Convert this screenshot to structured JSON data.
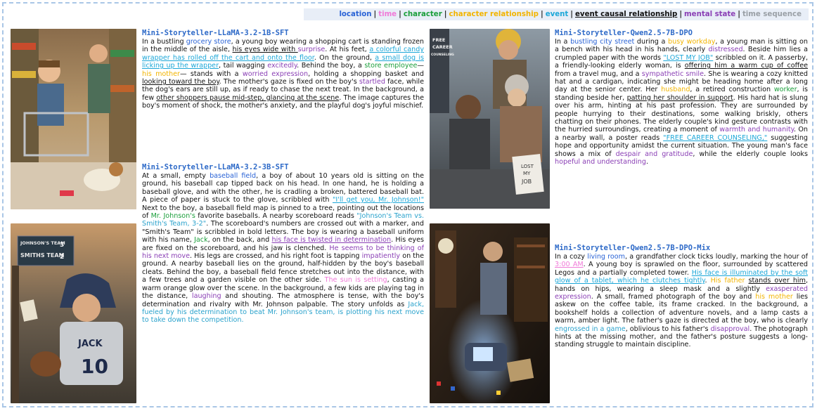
{
  "legend": [
    {
      "label": "location",
      "cls": "l-location"
    },
    {
      "label": "time",
      "cls": "l-time"
    },
    {
      "label": "character",
      "cls": "l-character"
    },
    {
      "label": "character relationship",
      "cls": "l-relationship"
    },
    {
      "label": "event",
      "cls": "l-event"
    },
    {
      "label": "event causal relationship",
      "cls": "l-causal"
    },
    {
      "label": "mental state",
      "cls": "l-mental"
    },
    {
      "label": "time sequence",
      "cls": "l-sequence"
    }
  ],
  "stories": [
    {
      "title": "Mini-Storyteller-LLaMA-3.2-1B-SFT",
      "segments": [
        [
          "In a bustling ",
          ""
        ],
        [
          "grocery store",
          "location"
        ],
        [
          ", a young boy wearing a shopping cart is standing frozen in the middle of the aisle, ",
          ""
        ],
        [
          "his eyes wide with ",
          "causal"
        ],
        [
          "surprise",
          "mental"
        ],
        [
          ". At his feet, ",
          ""
        ],
        [
          "a colorful candy wrapper has rolled off the cart and onto the floor",
          "event"
        ],
        [
          ". On the ground, ",
          ""
        ],
        [
          "a small dog is licking up the wrapper",
          "event"
        ],
        [
          ", tail wagging ",
          ""
        ],
        [
          "excitedly",
          "mental"
        ],
        [
          ". Behind the boy, a ",
          ""
        ],
        [
          "store employee",
          "character"
        ],
        [
          "—",
          ""
        ],
        [
          "his mother",
          "relationship"
        ],
        [
          "— stands with a ",
          ""
        ],
        [
          "worried expression",
          "mental"
        ],
        [
          ", holding a shopping basket and ",
          ""
        ],
        [
          "looking toward the boy",
          "causal"
        ],
        [
          ". The mother's gaze is fixed on the boy's ",
          ""
        ],
        [
          "startled",
          "mental"
        ],
        [
          " face, while the dog's ears are still up, as if ready to chase the next treat. In the background, a few ",
          ""
        ],
        [
          "other shoppers pause mid-step, glancing at the scene",
          "causal"
        ],
        [
          ". The image captures the boy's moment of shock, the mother's anxiety, and the playful dog's joyful mischief.",
          ""
        ]
      ]
    },
    {
      "title": "Mini-Storyteller-LLaMA-3.2-3B-SFT",
      "segments": [
        [
          "At a small, empty ",
          ""
        ],
        [
          "baseball field",
          "location"
        ],
        [
          ", a boy of about 10 years old is sitting on the ground, his baseball cap tipped back on his head. In one hand, he is holding a baseball glove, and with the other, he is cradling a broken, battered baseball bat. A piece of paper is stuck to the glove, scribbled with ",
          ""
        ],
        [
          "\"I'll get you, Mr. Johnson!\"",
          "event"
        ],
        [
          " Next to the boy, a baseball field map is pinned to a tree, pointing out the locations of ",
          ""
        ],
        [
          "Mr. Johnson's",
          "character"
        ],
        [
          " favorite baseballs. A nearby scoreboard reads ",
          ""
        ],
        [
          "\"Johnson's Team vs. Smith's Team, 3-2\"",
          "sequence"
        ],
        [
          ". The scoreboard's numbers are crossed out with a marker, and \"Smith's Team\" is scribbled in bold letters. The boy is wearing a baseball uniform with his name, ",
          ""
        ],
        [
          "Jack",
          "character"
        ],
        [
          ", on the back, and ",
          ""
        ],
        [
          "his face is twisted in determination",
          "mental-u"
        ],
        [
          ". His eyes are fixed on the scoreboard, and his jaw is clenched. ",
          ""
        ],
        [
          "He seems to be thinking of his next move",
          "mental"
        ],
        [
          ". His legs are crossed, and his right foot is tapping ",
          ""
        ],
        [
          "impatiently",
          "mental"
        ],
        [
          " on the ground. A nearby baseball lies on the ground, half-hidden by the boy's baseball cleats. Behind the boy, a baseball field fence stretches out into the distance, with a few trees and a garden visible on the other side. ",
          ""
        ],
        [
          "The sun is setting",
          "time"
        ],
        [
          ", casting a warm orange glow over the scene. In the background, a few kids are playing tag in the distance, ",
          ""
        ],
        [
          "laughing",
          "mental"
        ],
        [
          " and shouting. The atmosphere is tense, with the boy's determination and rivalry with Mr. Johnson palpable. The story unfolds as ",
          ""
        ],
        [
          "Jack, fueled by his determination to beat Mr. Johnson's team, is plotting his next move to take down the competition.",
          "sequence"
        ]
      ]
    },
    {
      "title": "Mini-Storyteller-Qwen2.5-7B-DPO",
      "segments": [
        [
          "In a ",
          ""
        ],
        [
          "bustling city street",
          "location"
        ],
        [
          " during a ",
          ""
        ],
        [
          "busy workday",
          "relationship"
        ],
        [
          ", a young man is sitting on a bench with his head in his hands, clearly ",
          ""
        ],
        [
          "distressed",
          "mental"
        ],
        [
          ". Beside him lies a crumpled paper with the words ",
          ""
        ],
        [
          "\"LOST MY JOB\"",
          "event"
        ],
        [
          " scribbled on it. A passerby, a friendly-looking elderly woman, is ",
          ""
        ],
        [
          "offering him a warm cup of coffee",
          "causal"
        ],
        [
          " from a travel mug, and a ",
          ""
        ],
        [
          "sympathetic smile",
          "mental"
        ],
        [
          ". She is wearing a cozy knitted hat and a cardigan, indicating she might be heading home after a long day at the senior center. Her ",
          ""
        ],
        [
          "husband",
          "relationship"
        ],
        [
          ", a retired construction ",
          ""
        ],
        [
          "worker",
          "character"
        ],
        [
          ", is standing beside her, ",
          ""
        ],
        [
          "patting her shoulder in support",
          "causal"
        ],
        [
          ". His hard hat is slung over his arm, hinting at his past profession. They are surrounded by people hurrying to their destinations, some walking briskly, others chatting on their phones. The elderly couple's kind gesture contrasts with the hurried surroundings, creating a moment of ",
          ""
        ],
        [
          "warmth and humanity",
          "mental"
        ],
        [
          ". On a nearby wall, a poster reads ",
          ""
        ],
        [
          "\"FREE CAREER COUNSELING,\"",
          "event"
        ],
        [
          " suggesting hope and opportunity amidst the current situation. The young man's face shows a mix of ",
          ""
        ],
        [
          "despair and gratitude",
          "mental"
        ],
        [
          ", while the elderly couple looks ",
          ""
        ],
        [
          "hopeful and understanding",
          "mental"
        ],
        [
          ".",
          ""
        ]
      ]
    },
    {
      "title": "Mini-Storyteller-Qwen2.5-7B-DPO-Mix",
      "segments": [
        [
          "In a cozy ",
          ""
        ],
        [
          "living room",
          "location"
        ],
        [
          ", a grandfather clock ticks loudly, marking the hour of ",
          ""
        ],
        [
          "3:00 AM",
          "time-u"
        ],
        [
          ". A young boy is sprawled on the floor, surrounded by scattered Legos and a partially completed tower. ",
          ""
        ],
        [
          "His face is illuminated by the soft glow of a tablet, which he clutches tightly",
          "event"
        ],
        [
          ". ",
          ""
        ],
        [
          "His father",
          "relationship"
        ],
        [
          " ",
          ""
        ],
        [
          "stands over him",
          "causal"
        ],
        [
          ", hands on hips, wearing a sleep mask and a slightly ",
          ""
        ],
        [
          "exasperated expression",
          "mental"
        ],
        [
          ". A small, framed photograph of the boy and ",
          ""
        ],
        [
          "his mother",
          "relationship"
        ],
        [
          " lies askew on the coffee table, its frame cracked. In the background, a bookshelf holds a collection of adventure novels, and a lamp casts a warm, amber light. The father's gaze is directed at the boy, who is clearly ",
          ""
        ],
        [
          "engrossed in a game",
          "sequence"
        ],
        [
          ", oblivious to his father's ",
          ""
        ],
        [
          "disapproval",
          "mental"
        ],
        [
          ". The photograph hints at the missing mother, and the father's posture suggests a long-standing struggle to maintain discipline.",
          ""
        ]
      ]
    }
  ],
  "image_texts": {
    "scoreboard_1": "JOHNSON'S TEAM",
    "scoreboard_2": "SMITHS TEAM",
    "scoreboard_3": "3",
    "scoreboard_4": "2",
    "jersey_name": "JACK",
    "jersey_number": "10",
    "poster_1": "FREE",
    "poster_2": "CAREER",
    "poster_3": "COUNSELING",
    "sign_1": "LOST",
    "sign_2": "MY",
    "sign_3": "JOB"
  }
}
